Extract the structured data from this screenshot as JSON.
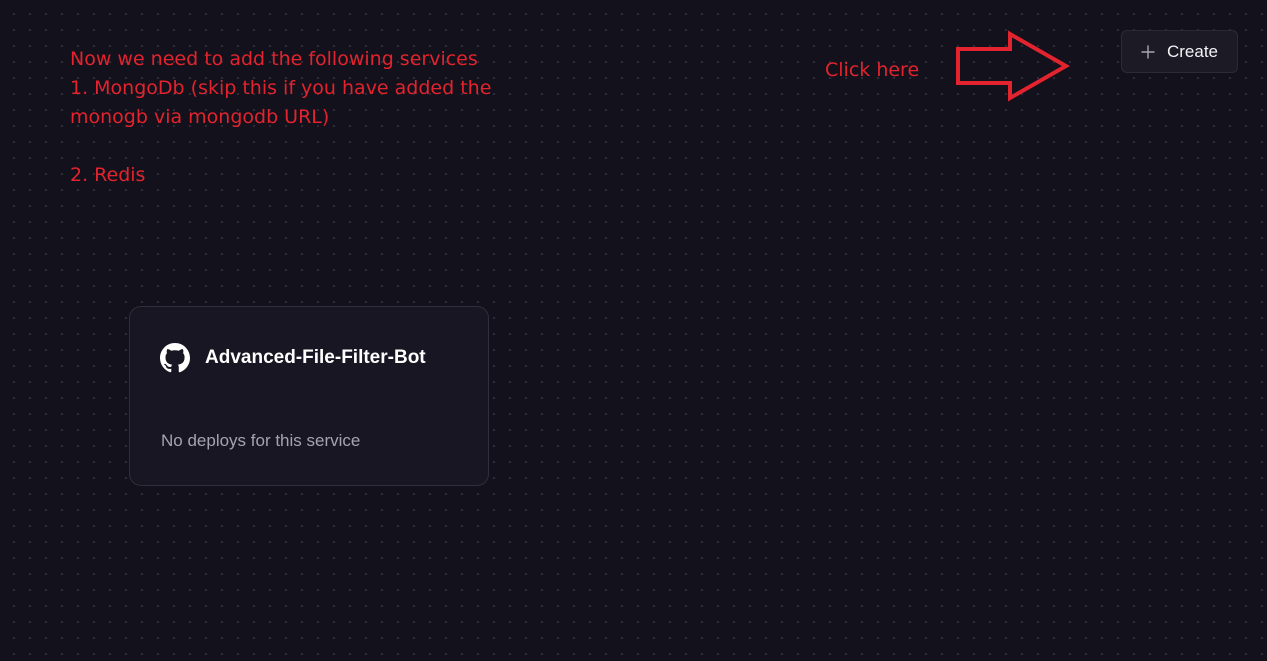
{
  "annotations": {
    "instructions": {
      "line1": "Now we need to add the following services",
      "line2": "1. MongoDb (skip this if you have added the",
      "line3": "monogb via mongodb URL)",
      "line4": "2. Redis"
    },
    "click_hint": "Click here",
    "color": "#e3232d",
    "arrow_icon": "outline-right-arrow"
  },
  "toolbar": {
    "create_label": "Create",
    "create_icon": "plus-icon"
  },
  "service_card": {
    "icon": "github-icon",
    "name": "Advanced-File-Filter-Bot",
    "status": "No deploys for this service"
  },
  "colors": {
    "canvas_background": "#13111c",
    "card_background": "#181622",
    "button_background": "#1b1a25",
    "annotation_red": "#e3232d"
  }
}
